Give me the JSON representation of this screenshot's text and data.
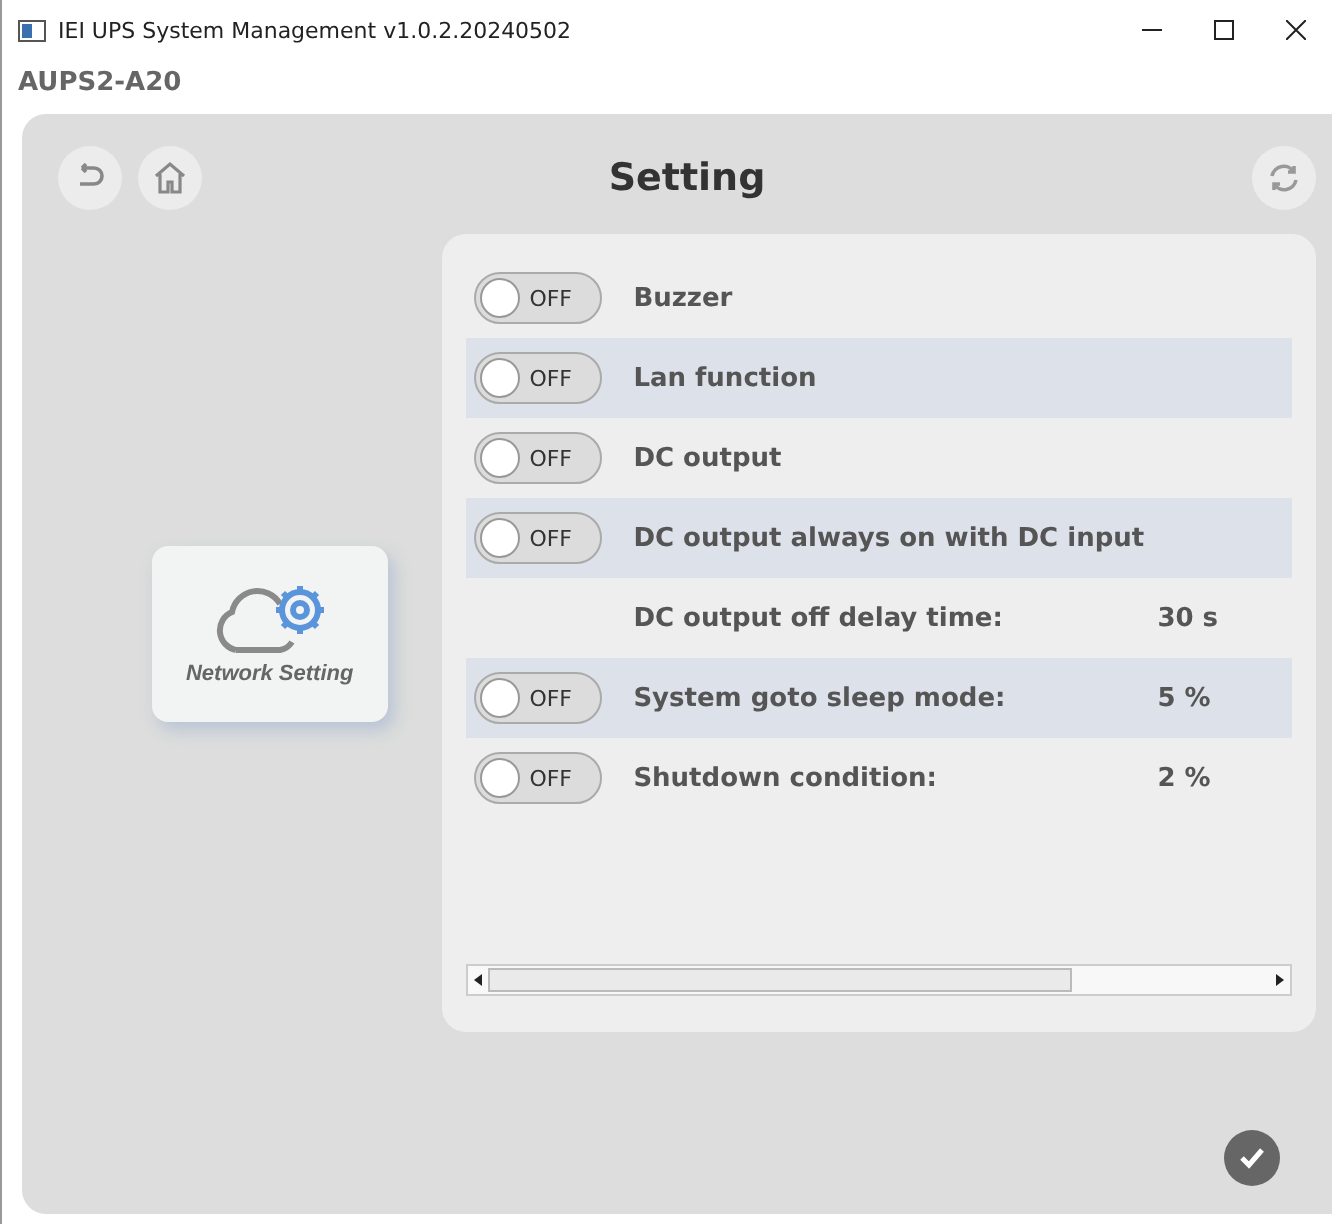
{
  "window": {
    "title": "IEI UPS System Management  v1.0.2.20240502"
  },
  "device": "AUPS2-A20",
  "header": {
    "title": "Setting"
  },
  "network_tile": {
    "label": "Network Setting"
  },
  "settings": [
    {
      "kind": "toggle",
      "on": false,
      "toggle_label": "OFF",
      "label": "Buzzer"
    },
    {
      "kind": "toggle",
      "on": false,
      "toggle_label": "OFF",
      "label": "Lan function"
    },
    {
      "kind": "toggle",
      "on": false,
      "toggle_label": "OFF",
      "label": "DC output"
    },
    {
      "kind": "toggle",
      "on": false,
      "toggle_label": "OFF",
      "label": "DC output always on with DC input"
    },
    {
      "kind": "value",
      "label": "DC output off delay time:",
      "value": "30 s"
    },
    {
      "kind": "toggle",
      "on": false,
      "toggle_label": "OFF",
      "label": "System goto sleep mode:",
      "value": "5 %"
    },
    {
      "kind": "toggle",
      "on": false,
      "toggle_label": "OFF",
      "label": "Shutdown condition:",
      "value": "2 %"
    }
  ]
}
